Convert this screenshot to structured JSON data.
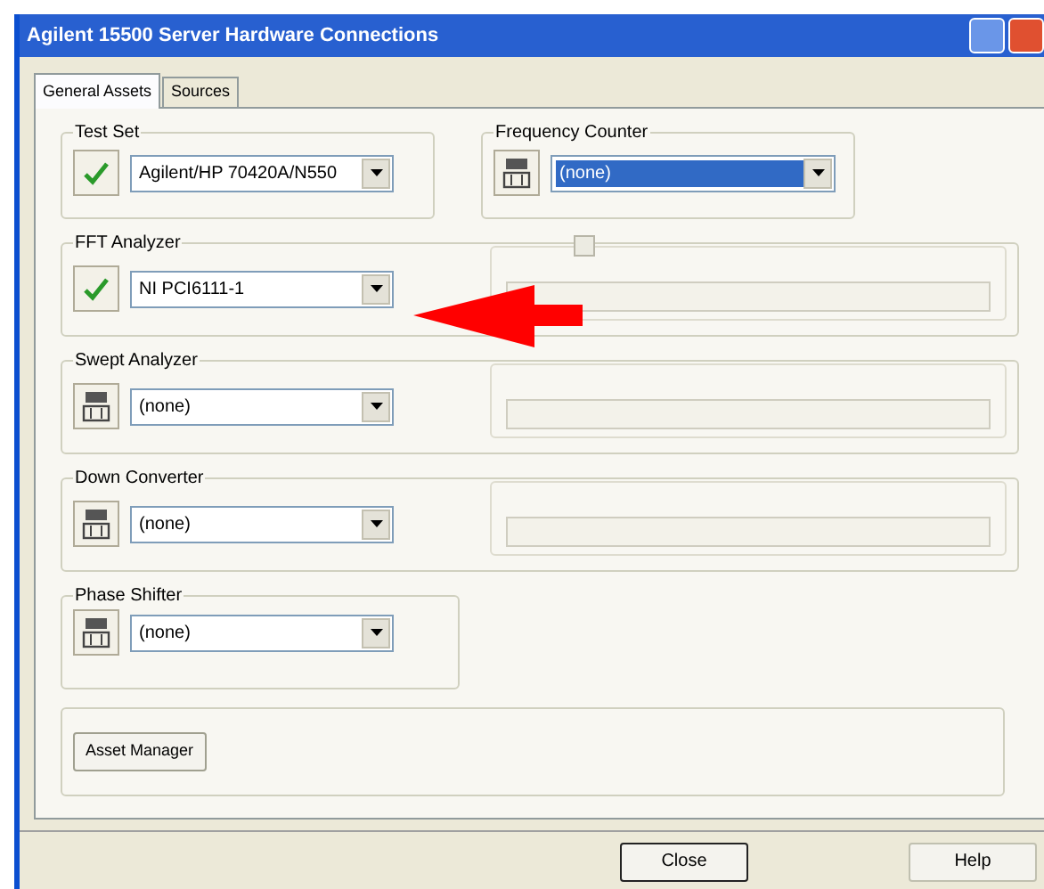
{
  "window": {
    "title": "Agilent 15500 Server Hardware Connections"
  },
  "tabs": [
    {
      "label": "General Assets",
      "selected": true
    },
    {
      "label": "Sources",
      "selected": false
    }
  ],
  "top_groups": [
    {
      "label": "Test Set",
      "connected": true,
      "value": "Agilent/HP 70420A/N550",
      "focused": false
    },
    {
      "label": "Frequency Counter",
      "connected": false,
      "value": "(none)",
      "focused": true
    }
  ],
  "groups": [
    {
      "label": "FFT Analyzer",
      "connected": true,
      "value": "NI PCI6111-1",
      "sub_panel": true,
      "sub_check": true
    },
    {
      "label": "Swept Analyzer",
      "connected": false,
      "value": "(none)",
      "sub_panel": true,
      "sub_check": false
    },
    {
      "label": "Down Converter",
      "connected": false,
      "value": "(none)",
      "sub_panel": true,
      "sub_check": false
    },
    {
      "label": "Phase Shifter",
      "connected": false,
      "value": "(none)",
      "sub_panel": false
    }
  ],
  "asset_button": "Asset Manager",
  "buttons": [
    "Close",
    "Help"
  ]
}
